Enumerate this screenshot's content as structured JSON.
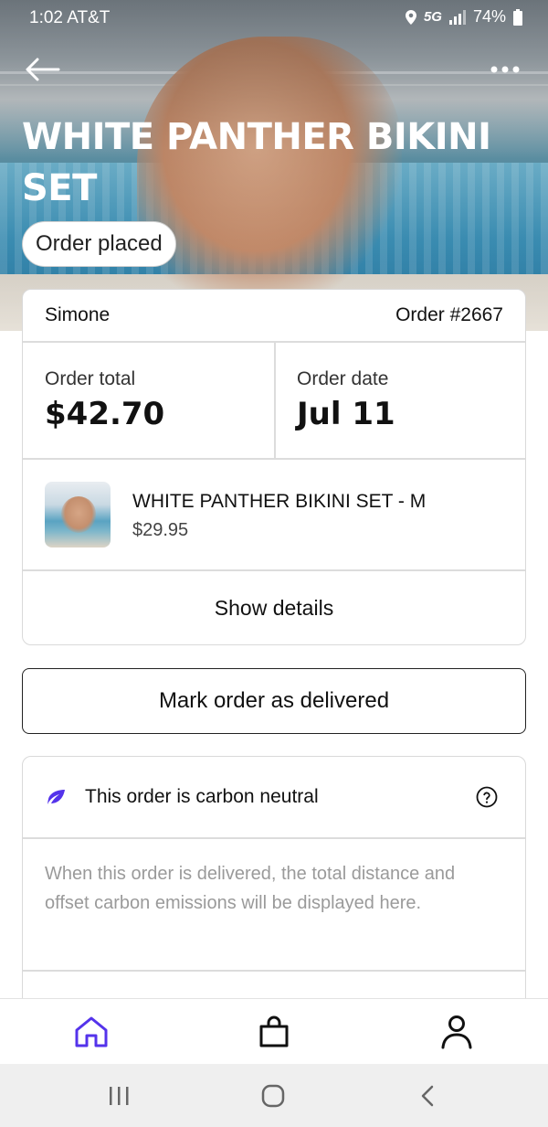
{
  "status_bar": {
    "time": "1:02 AT&T",
    "network": "5G",
    "battery": "74%"
  },
  "header": {
    "title": "WHITE PANTHER BIKINI SET",
    "status_pill": "Order placed"
  },
  "order": {
    "customer": "Simone",
    "number": "Order #2667",
    "total_label": "Order total",
    "total_value": "$42.70",
    "date_label": "Order date",
    "date_value": "Jul 11",
    "item_title": "WHITE PANTHER BIKINI SET - M",
    "item_price": "$29.95",
    "details_label": "Show details"
  },
  "actions": {
    "mark_delivered": "Mark order as delivered"
  },
  "carbon": {
    "title": "This order is carbon neutral",
    "description": "When this order is delivered, the total distance and offset carbon emissions will be displayed here."
  },
  "nav": {
    "items": [
      "home-icon",
      "bag-icon",
      "account-icon"
    ],
    "active": "home-icon"
  },
  "colors": {
    "accent": "#5433eb"
  }
}
